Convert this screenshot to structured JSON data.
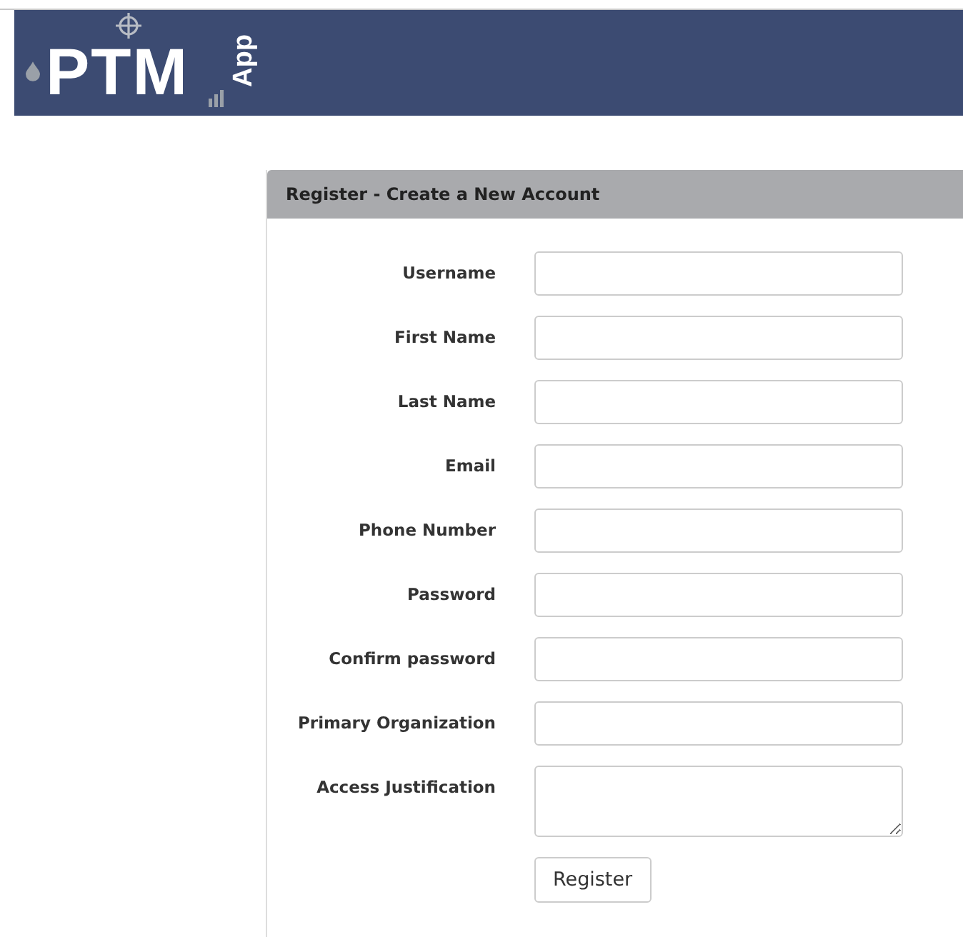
{
  "header": {
    "logo_text": "PTM",
    "logo_sub": "App"
  },
  "panel": {
    "title": "Register - Create a New Account",
    "fields": [
      {
        "label": "Username",
        "kind": "text"
      },
      {
        "label": "First Name",
        "kind": "text"
      },
      {
        "label": "Last Name",
        "kind": "text"
      },
      {
        "label": "Email",
        "kind": "text"
      },
      {
        "label": "Phone Number",
        "kind": "text"
      },
      {
        "label": "Password",
        "kind": "text"
      },
      {
        "label": "Confirm password",
        "kind": "text"
      },
      {
        "label": "Primary Organization",
        "kind": "text"
      },
      {
        "label": "Access Justification",
        "kind": "textarea"
      }
    ],
    "submit": "Register"
  }
}
